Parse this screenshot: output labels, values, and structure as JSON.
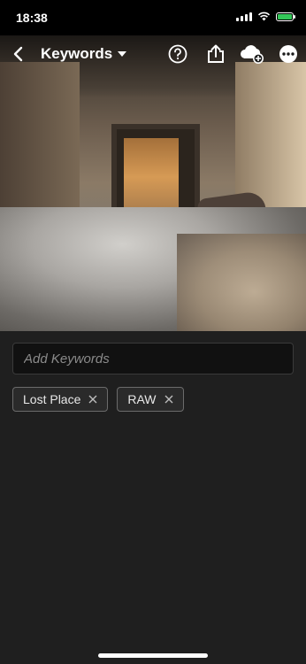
{
  "status_bar": {
    "time": "18:38"
  },
  "header": {
    "title": "Keywords"
  },
  "keywords": {
    "placeholder": "Add Keywords",
    "tags": [
      {
        "label": "Lost Place"
      },
      {
        "label": "RAW"
      }
    ]
  },
  "icons": {
    "back": "chevron-left-icon",
    "dropdown": "caret-down-icon",
    "help": "help-circle-icon",
    "share": "share-icon",
    "cloud": "cloud-add-icon",
    "more": "more-icon",
    "remove": "close-icon"
  },
  "colors": {
    "background": "#1f1f1f",
    "battery": "#34c759"
  }
}
